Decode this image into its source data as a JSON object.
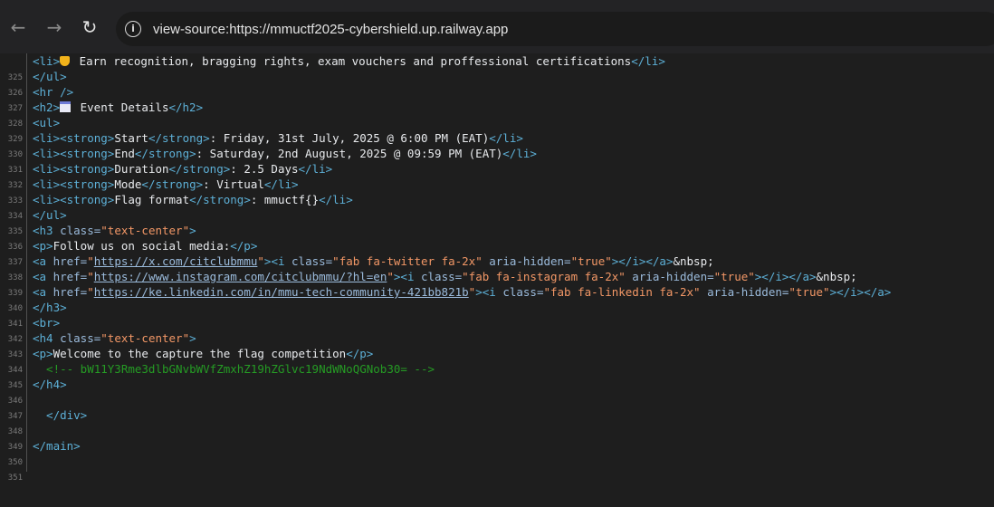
{
  "browser": {
    "back_glyph": "←",
    "forward_glyph": "→",
    "reload_glyph": "↻",
    "info_glyph": "i",
    "url": "view-source:https://mmuctf2025-cybershield.up.railway.app"
  },
  "source": {
    "line_numbers": [
      "325",
      "326",
      "327",
      "328",
      "329",
      "330",
      "331",
      "332",
      "333",
      "334",
      "335",
      "336",
      "337",
      "338",
      "339",
      "340",
      "341",
      "342",
      "343",
      "344",
      "345",
      "346",
      "347",
      "348",
      "349",
      "350",
      "351"
    ],
    "l325": {
      "open": "<li>",
      "text": " Earn recognition, bragging rights, exam vouchers and proffessional certifications",
      "close": "</li>"
    },
    "l326": "</ul>",
    "l327": "<hr />",
    "l328": {
      "open": "<h2>",
      "text": " Event Details",
      "close": "</h2>"
    },
    "l329": "<ul>",
    "items": [
      {
        "open": "<li><strong>",
        "label": "Start",
        "mid": "</strong>",
        "text": ": Friday, 31st July, 2025 @ 6:00 PM (EAT)",
        "close": "</li>"
      },
      {
        "open": "<li><strong>",
        "label": "End",
        "mid": "</strong>",
        "text": ": Saturday, 2nd August, 2025 @ 09:59 PM (EAT)",
        "close": "</li>"
      },
      {
        "open": "<li><strong>",
        "label": "Duration",
        "mid": "</strong>",
        "text": ": 2.5 Days",
        "close": "</li>"
      },
      {
        "open": "<li><strong>",
        "label": "Mode",
        "mid": "</strong>",
        "text": ": Virtual",
        "close": "</li>"
      },
      {
        "open": "<li><strong>",
        "label": "Flag format",
        "mid": "</strong>",
        "text": ": mmuctf{}",
        "close": "</li>"
      }
    ],
    "l335": "</ul>",
    "l336": {
      "open": "<h3 ",
      "attr": "class=",
      "val": "\"text-center\"",
      "close": ">"
    },
    "l337": {
      "open": "<p>",
      "text": "Follow us on social media:",
      "close": "</p>"
    },
    "links": [
      {
        "a_open": "<a ",
        "href_attr": "href=",
        "q1": "\"",
        "url": "https://x.com/citclubmmu",
        "q2": "\"",
        "gt": ">",
        "i_open": "<i ",
        "class_attr": "class=",
        "class_val": "\"fab fa-twitter fa-2x\"",
        "aria_attr": " aria-hidden=",
        "aria_val": "\"true\"",
        "i_close": "></i></a>",
        "tail": "&nbsp;"
      },
      {
        "a_open": "<a ",
        "href_attr": "href=",
        "q1": "\"",
        "url": "https://www.instagram.com/citclubmmu/?hl=en",
        "q2": "\"",
        "gt": ">",
        "i_open": "<i ",
        "class_attr": "class=",
        "class_val": "\"fab fa-instagram fa-2x\"",
        "aria_attr": " aria-hidden=",
        "aria_val": "\"true\"",
        "i_close": "></i></a>",
        "tail": "&nbsp;"
      },
      {
        "a_open": "<a ",
        "href_attr": "href=",
        "q1": "\"",
        "url": "https://ke.linkedin.com/in/mmu-tech-community-421bb821b",
        "q2": "\"",
        "gt": ">",
        "i_open": "<i ",
        "class_attr": "class=",
        "class_val": "\"fab fa-linkedin fa-2x\"",
        "aria_attr": " aria-hidden=",
        "aria_val": "\"true\"",
        "i_close": "></i></a>",
        "tail": ""
      }
    ],
    "l341": "</h3>",
    "l342": "<br>",
    "l343": {
      "open": "<h4 ",
      "attr": "class=",
      "val": "\"text-center\"",
      "close": ">"
    },
    "l344": {
      "open": "<p>",
      "text": "Welcome to the capture the flag competition",
      "close": "</p>"
    },
    "l345": "  <!-- bW11Y3Rme3dlbGNvbWVfZmxhZ19hZGlvc19NdWNoQGNob30= -->",
    "l346": "</h4>",
    "l348": "  </div>",
    "l350": "</main>"
  },
  "colors": {
    "tag": "#5db0d7",
    "attribute": "#9bbbdc",
    "value": "#f29766",
    "comment": "#259b24",
    "text": "#e8eaed",
    "line_number": "#7a7a7a"
  }
}
